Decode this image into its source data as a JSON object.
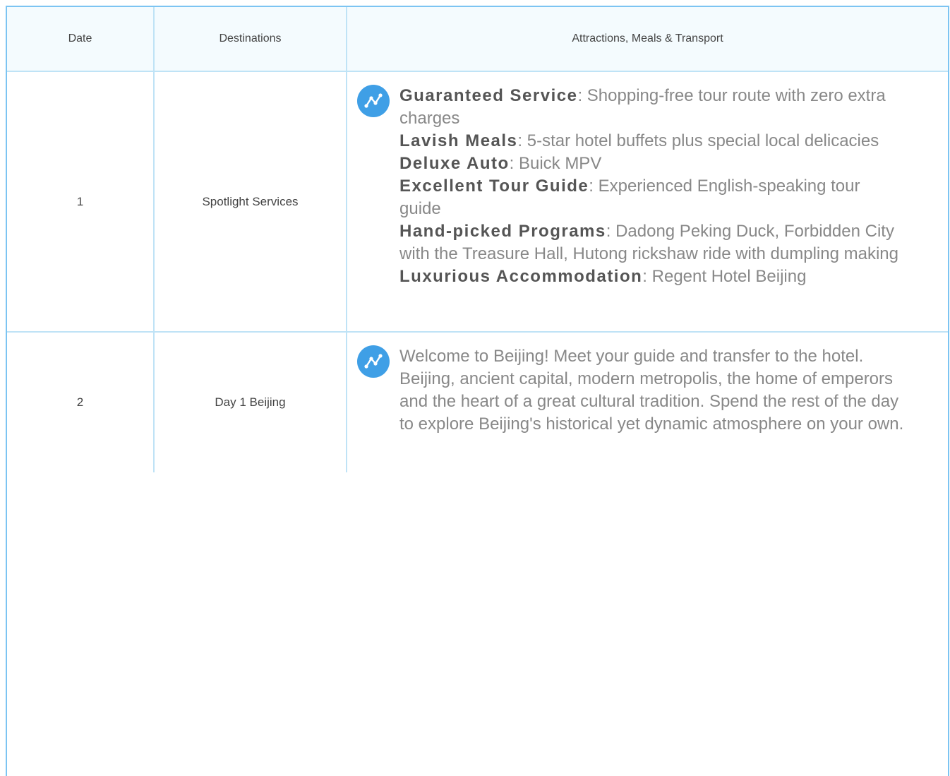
{
  "table": {
    "headers": {
      "date": "Date",
      "destinations": "Destinations",
      "details": "Attractions, Meals & Transport"
    },
    "rows": [
      {
        "date": "1",
        "destination": "Spotlight Services",
        "icon": "route-icon",
        "services": [
          {
            "name": "Guaranteed Service",
            "text": ": Shopping-free tour route with zero extra charges"
          },
          {
            "name": "Lavish Meals",
            "text": ": 5-star hotel buffets plus special local delicacies"
          },
          {
            "name": "Deluxe Auto",
            "text": ": Buick MPV"
          },
          {
            "name": "Excellent Tour Guide",
            "text": ": Experienced English-speaking tour guide"
          },
          {
            "name": "Hand-picked Programs",
            "text": ": Dadong Peking Duck, Forbidden City with the Treasure Hall, Hutong rickshaw ride with dumpling making"
          },
          {
            "name": "Luxurious Accommodation",
            "text": ": Regent Hotel Beijing"
          }
        ]
      },
      {
        "date": "2",
        "destination": "Day 1 Beijing",
        "icon": "route-icon",
        "description": "Welcome to Beijing! Meet your guide and transfer to the hotel. Beijing, ancient capital, modern metropolis, the home of emperors and the heart of a great cultural tradition. Spend the rest of the day to explore Beijing's historical yet dynamic atmosphere on your own."
      }
    ]
  },
  "colors": {
    "border_outer": "#7cc4f2",
    "border_inner": "#bfe3f6",
    "header_bg": "#f4fbfe",
    "icon_bg": "#3f9fe6",
    "text_muted": "#888888",
    "text_bold": "#555555"
  }
}
